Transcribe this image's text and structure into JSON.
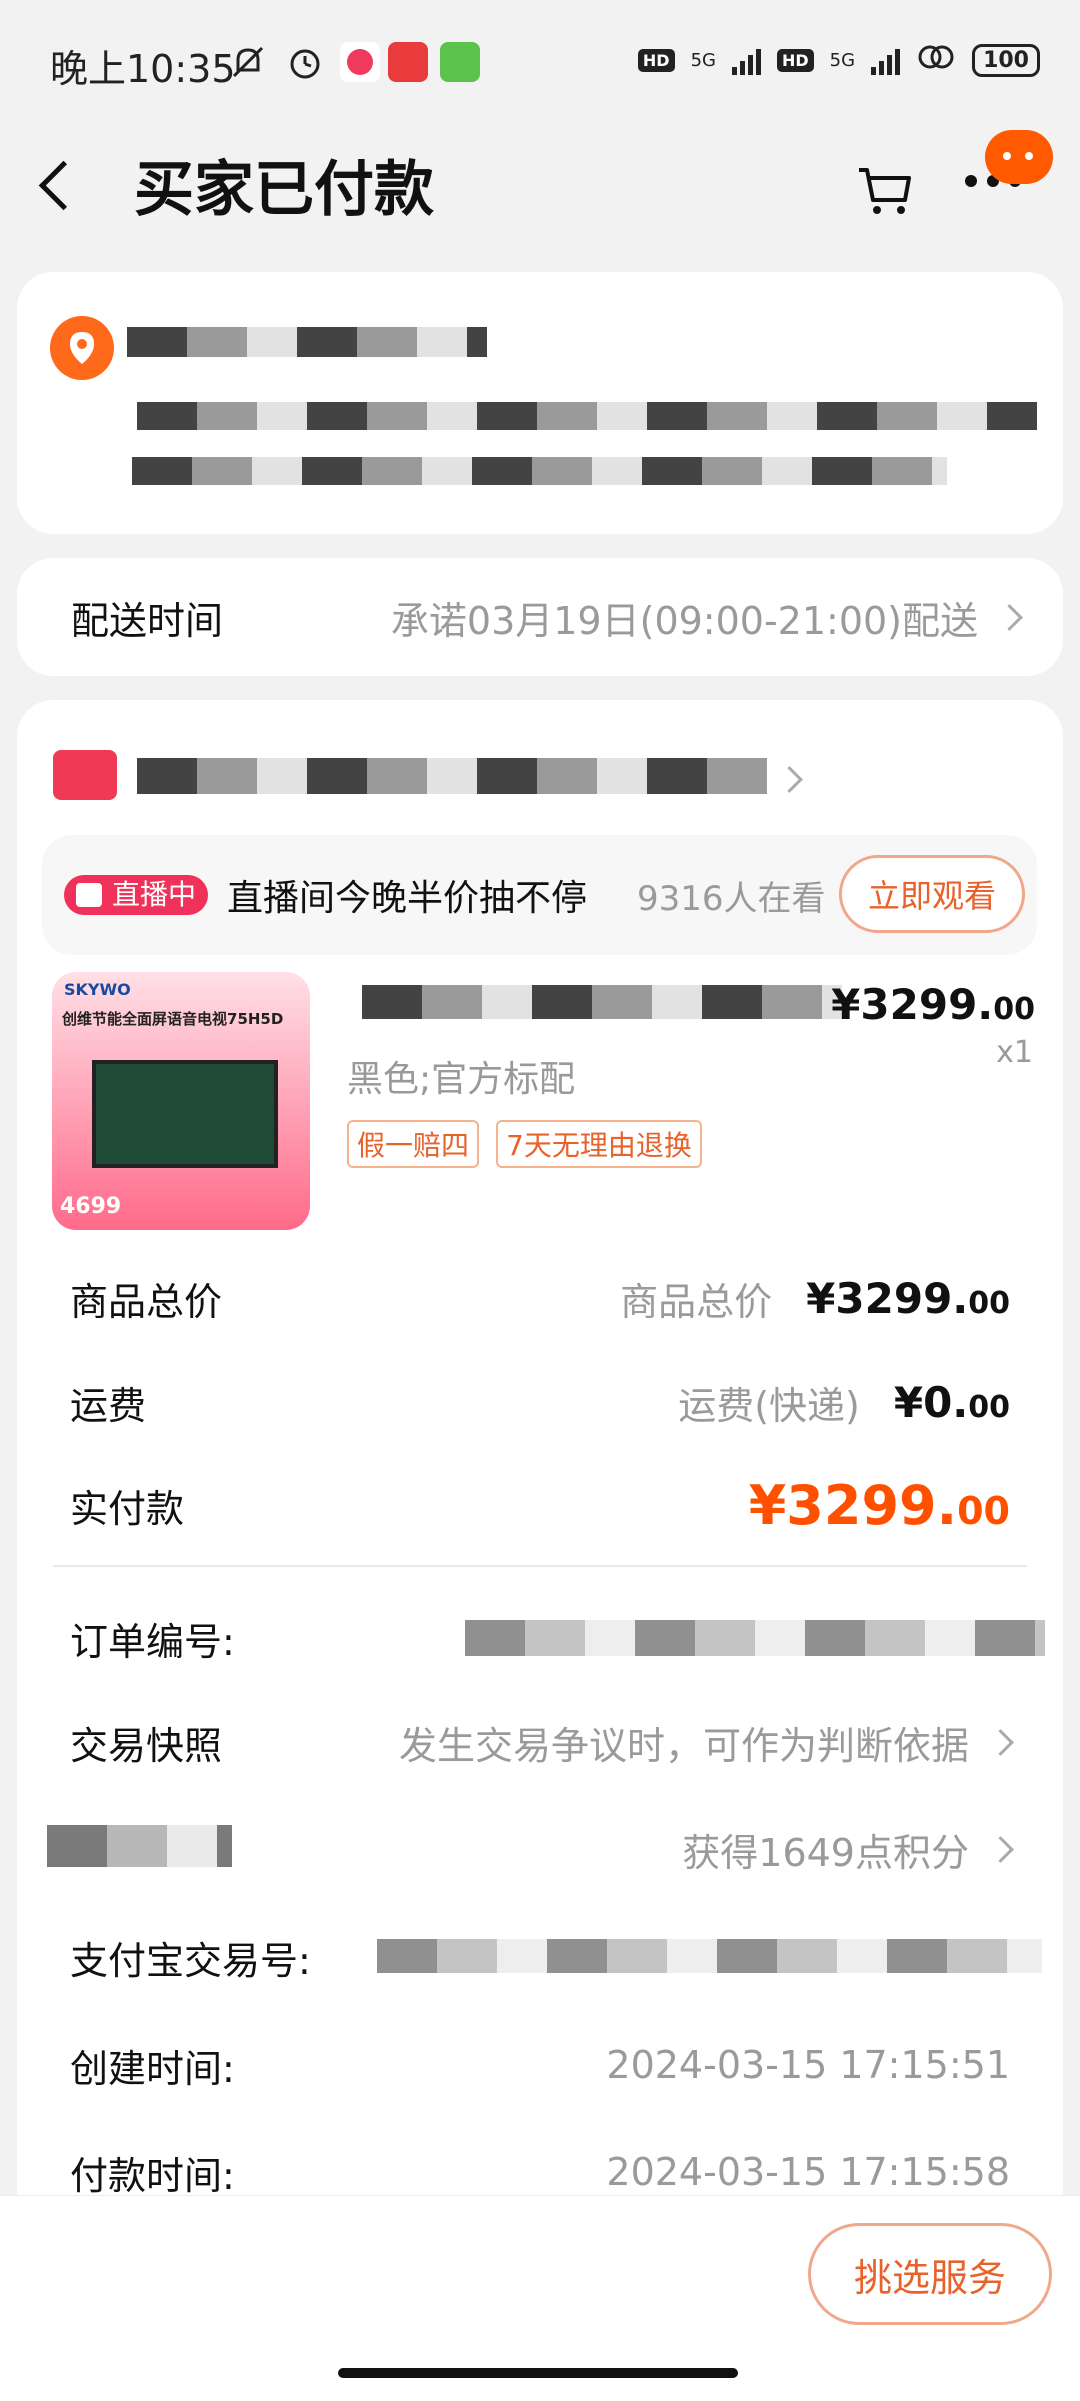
{
  "status_bar": {
    "time": "晚上10:35",
    "hd1": "HD",
    "net1": "5G",
    "hd2": "HD",
    "net2": "5G",
    "battery": "100"
  },
  "header": {
    "title": "买家已付款"
  },
  "delivery": {
    "label": "配送时间",
    "value": "承诺03月19日(09:00-21:00)配送"
  },
  "live": {
    "badge": "直播中",
    "text": "直播间今晚半价抽不停",
    "viewers": "9316人在看",
    "button": "立即观看"
  },
  "product": {
    "image_brand": "SKYWO",
    "image_title": "创维节能全面屏语音电视75H5D",
    "image_price": "4699",
    "spec": "黑色;官方标配",
    "tags": [
      "假一赔四",
      "7天无理由退换"
    ],
    "price_main": "¥3299.",
    "price_dec": "00",
    "qty": "x1"
  },
  "summary": {
    "goods_total_label": "商品总价",
    "goods_total_sub": "商品总价",
    "goods_total_main": "¥3299.",
    "goods_total_dec": "00",
    "shipping_label": "运费",
    "shipping_sub": "运费(快递)",
    "shipping_main": "¥0.",
    "shipping_dec": "00",
    "paid_label": "实付款",
    "paid_main": "¥3299.",
    "paid_dec": "00"
  },
  "details": {
    "order_no_label": "订单编号:",
    "snapshot_label": "交易快照",
    "snapshot_value": "发生交易争议时，可作为判断依据",
    "points_value": "获得1649点积分",
    "alipay_label": "支付宝交易号:",
    "created_label": "创建时间:",
    "created_value": "2024-03-15 17:15:51",
    "paid_time_label": "付款时间:",
    "paid_time_value": "2024-03-15 17:15:58"
  },
  "footer": {
    "button": "挑选服务"
  },
  "colors": {
    "accent": "#ff5000",
    "background": "#f2f2f2"
  }
}
